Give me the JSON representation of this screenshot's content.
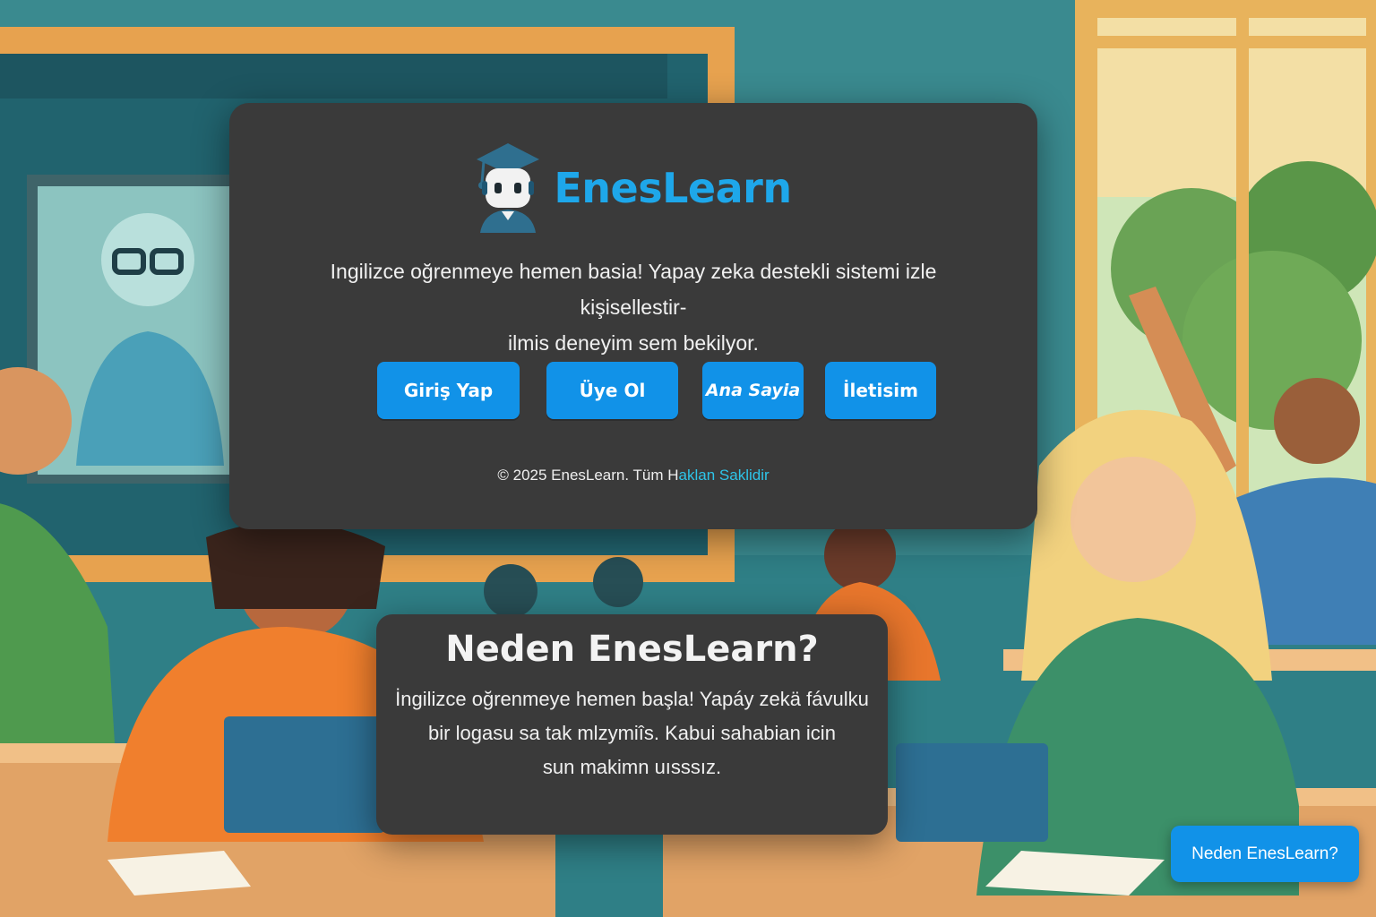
{
  "brand": {
    "name": "EnesLearn",
    "logo_icon": "graduation-robot-icon"
  },
  "hero": {
    "intro_line1": "Ingilizce oğrenmeye hemen basia! Yapay zeka destekli sistemi izle kişisellestir-",
    "intro_line2": "ilmis deneyim sem bekilyor."
  },
  "nav": {
    "login": "Giriş Yap",
    "register": "Üye Ol",
    "home": "Ana Sayia",
    "contact": "İletisim"
  },
  "footer": {
    "prefix": "© 2025 EnesLearn. Tüm H",
    "highlight": "aklan Saklidir"
  },
  "why": {
    "title": "Neden EnesLearn?",
    "line1": "İngilizce oğrenmeye hemen başla! Yapáy zekä  fávulku",
    "line2": "bir logasu sa tak mlzymiîs. Kabui sahabian icin",
    "line3": "sun makimn uısssız."
  },
  "floating_button": {
    "label": "Neden EnesLearn?"
  },
  "colors": {
    "accent": "#1192e8",
    "brand": "#1ea7ea",
    "card": "#3a3a3a",
    "highlight": "#2ec4e8"
  }
}
